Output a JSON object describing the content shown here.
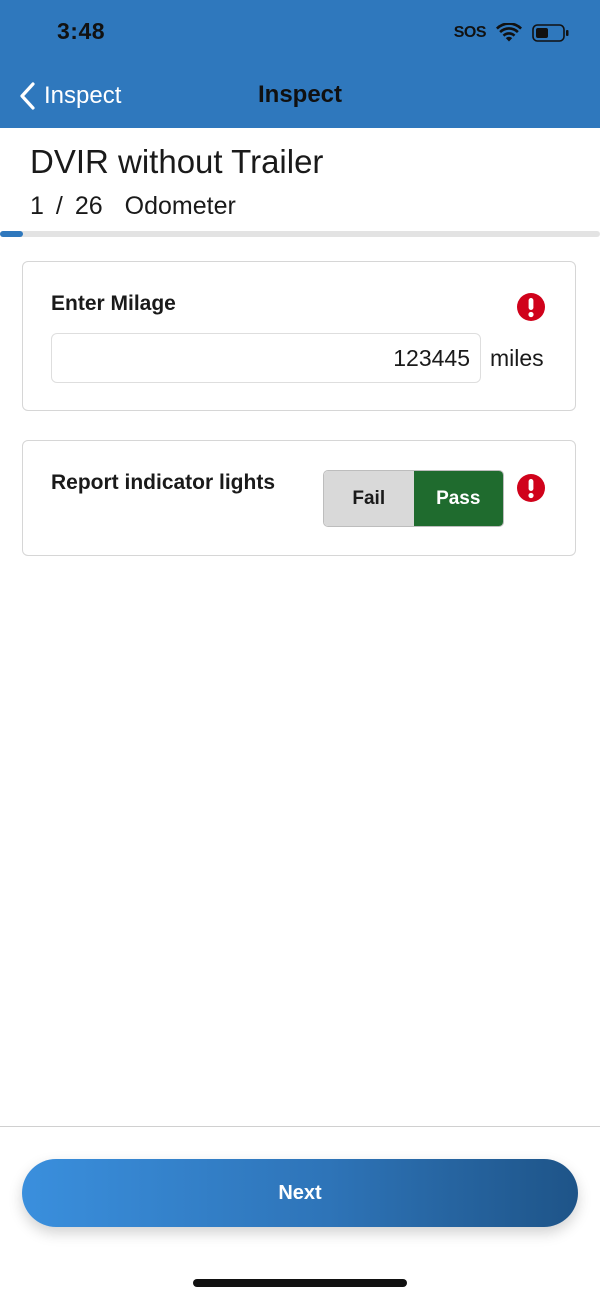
{
  "status_bar": {
    "time": "3:48",
    "sos": "SOS",
    "icons": [
      "wifi-icon",
      "battery-icon"
    ]
  },
  "nav": {
    "back_label": "Inspect",
    "title": "Inspect"
  },
  "header": {
    "title": "DVIR without Trailer",
    "step_current": "1",
    "step_separator": "/",
    "step_total": "26",
    "step_name": "Odometer",
    "progress_fraction": 0.038
  },
  "milage_card": {
    "label": "Enter Milage",
    "value": "123445",
    "unit": "miles",
    "alert_icon": "exclamation-circle-icon"
  },
  "lights_card": {
    "label": "Report indicator lights",
    "options": [
      "Fail",
      "Pass"
    ],
    "selected": "Pass",
    "alert_icon": "exclamation-circle-icon"
  },
  "footer": {
    "next_label": "Next"
  },
  "colors": {
    "header_blue": "#2f78bd",
    "pass_green": "#1f6b2e",
    "fail_gray": "#d9d9d9",
    "alert_red": "#d0021b"
  }
}
